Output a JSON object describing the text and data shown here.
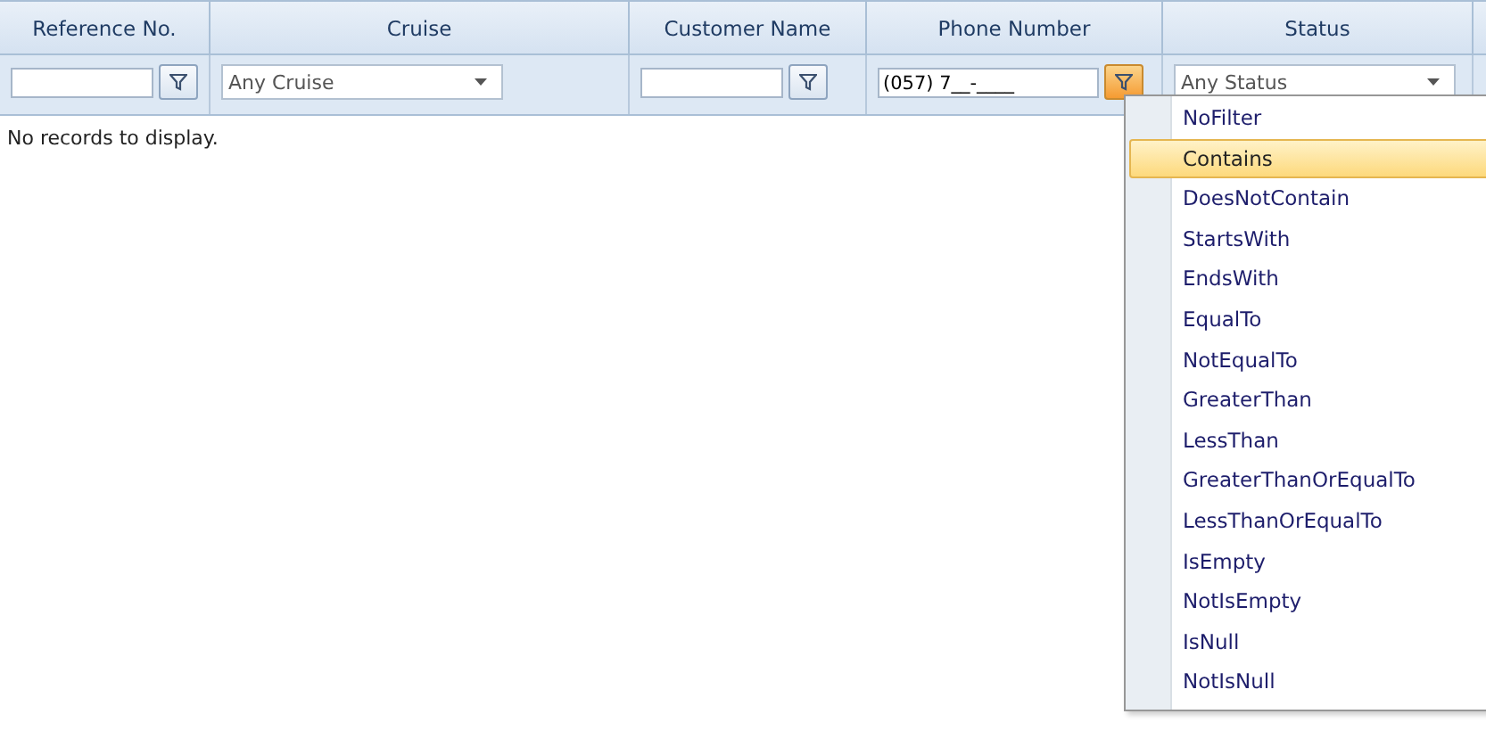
{
  "columns": [
    {
      "header": "Reference No.",
      "filter": {
        "kind": "text",
        "button_active": false
      }
    },
    {
      "header": "Cruise",
      "filter": {
        "kind": "dropdown",
        "value": "Any Cruise"
      }
    },
    {
      "header": "Customer Name",
      "filter": {
        "kind": "text",
        "button_active": false
      }
    },
    {
      "header": "Phone Number",
      "filter": {
        "kind": "text",
        "value": "(057) 7__-____",
        "button_active": true
      }
    },
    {
      "header": "Status",
      "filter": {
        "kind": "dropdown",
        "value": "Any Status"
      }
    }
  ],
  "empty_message": "No records to display.",
  "filter_menu": {
    "items": [
      {
        "label": "NoFilter",
        "selected": false
      },
      {
        "label": "Contains",
        "selected": true
      },
      {
        "label": "DoesNotContain",
        "selected": false
      },
      {
        "label": "StartsWith",
        "selected": false
      },
      {
        "label": "EndsWith",
        "selected": false
      },
      {
        "label": "EqualTo",
        "selected": false
      },
      {
        "label": "NotEqualTo",
        "selected": false
      },
      {
        "label": "GreaterThan",
        "selected": false
      },
      {
        "label": "LessThan",
        "selected": false
      },
      {
        "label": "GreaterThanOrEqualTo",
        "selected": false
      },
      {
        "label": "LessThanOrEqualTo",
        "selected": false
      },
      {
        "label": "IsEmpty",
        "selected": false
      },
      {
        "label": "NotIsEmpty",
        "selected": false
      },
      {
        "label": "IsNull",
        "selected": false
      },
      {
        "label": "NotIsNull",
        "selected": false
      }
    ]
  }
}
